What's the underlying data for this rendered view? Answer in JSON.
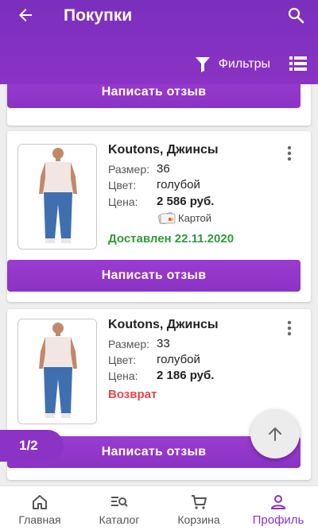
{
  "header": {
    "title": "Покупки",
    "filter_label": "Фильтры"
  },
  "orders": [
    {
      "review_label": "Написать отзыв"
    },
    {
      "name": "Koutons, Джинсы",
      "size_label": "Размер:",
      "size": "36",
      "color_label": "Цвет:",
      "color": "голубой",
      "price_label": "Цена:",
      "price": "2 586 руб.",
      "payment": "Картой",
      "status": "Доставлен 22.11.2020",
      "status_color": "#2e9b3a",
      "review_label": "Написать отзыв"
    },
    {
      "name": "Koutons, Джинсы",
      "size_label": "Размер:",
      "size": "33",
      "color_label": "Цвет:",
      "color": "голубой",
      "price_label": "Цена:",
      "price": "2 186 руб.",
      "status": "Возврат",
      "status_color": "#e0474c",
      "review_label": "Написать отзыв"
    }
  ],
  "pager": "1/2",
  "nav": [
    {
      "label": "Главная",
      "icon": "home-icon"
    },
    {
      "label": "Каталог",
      "icon": "catalog-search-icon"
    },
    {
      "label": "Корзина",
      "icon": "cart-icon"
    },
    {
      "label": "Профиль",
      "icon": "profile-icon",
      "active": true
    }
  ],
  "colors": {
    "accent": "#8a33c4",
    "delivered": "#2e9b3a",
    "returned": "#e0474c"
  }
}
